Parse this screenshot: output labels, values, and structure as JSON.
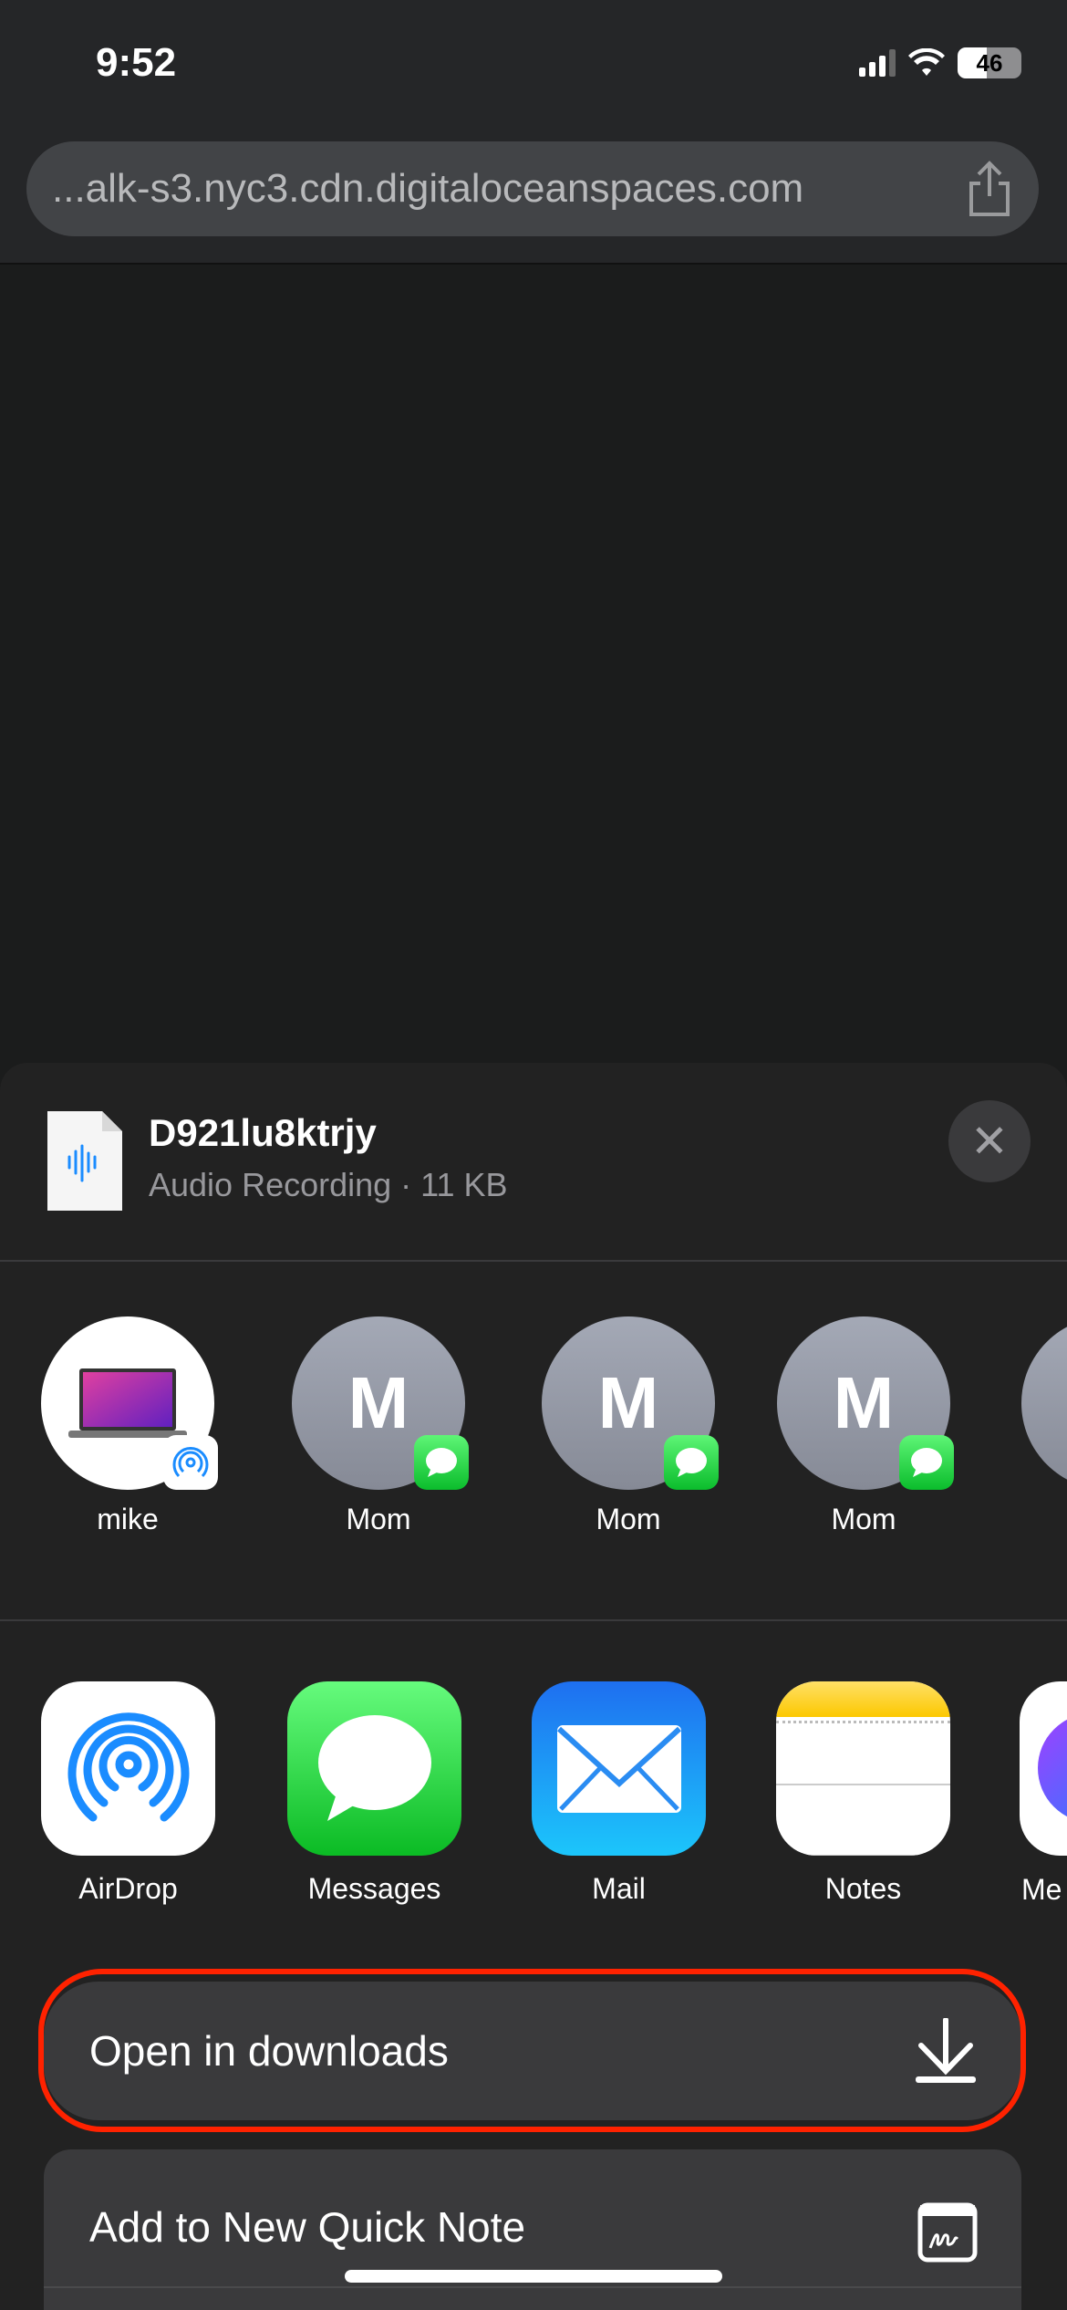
{
  "status_bar": {
    "time": "9:52",
    "battery": "46"
  },
  "browser": {
    "url": "...alk-s3.nyc3.cdn.digitaloceanspaces.com",
    "share_icon": "share-icon"
  },
  "share_sheet": {
    "file": {
      "name": "D921lu8ktrjy",
      "subtitle": "Audio Recording · 11 KB",
      "icon": "audio-file-icon"
    },
    "close_icon": "close-icon",
    "people": [
      {
        "label": "mike",
        "initial": "",
        "badge": "airdrop"
      },
      {
        "label": "Mom",
        "initial": "M",
        "badge": "messages"
      },
      {
        "label": "Mom",
        "initial": "M",
        "badge": "messages"
      },
      {
        "label": "Mom",
        "initial": "M",
        "badge": "messages"
      }
    ],
    "apps": [
      {
        "label": "AirDrop"
      },
      {
        "label": "Messages"
      },
      {
        "label": "Mail"
      },
      {
        "label": "Notes"
      },
      {
        "label": "Me"
      }
    ],
    "actions": [
      {
        "label": "Open in downloads",
        "icon": "download-icon"
      },
      {
        "label": "Add to New Quick Note",
        "icon": "quick-note-icon"
      }
    ]
  },
  "colors": {
    "highlight": "#ff2200",
    "accent_blue": "#1a8cff",
    "messages_green": "#34c759"
  }
}
